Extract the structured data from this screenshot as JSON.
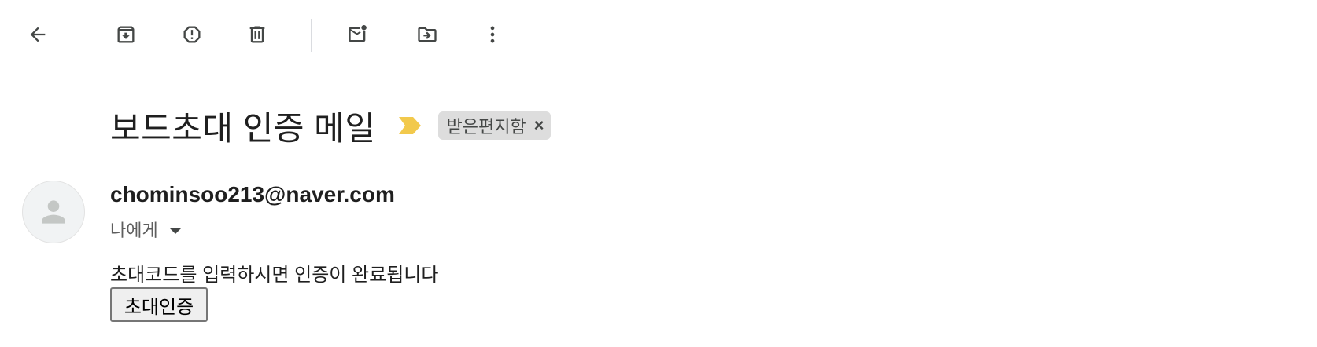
{
  "toolbar": {
    "icons": [
      "back-arrow-icon",
      "archive-icon",
      "report-spam-icon",
      "delete-icon",
      "mark-unread-icon",
      "move-to-icon",
      "more-vert-icon"
    ]
  },
  "message": {
    "subject": "보드초대 인증 메일",
    "importance_color": "#f2c94c",
    "label": "받은편지함",
    "label_close": "×"
  },
  "sender": {
    "email": "chominsoo213@naver.com",
    "recipient": "나에게"
  },
  "body": {
    "text": "초대코드를 입력하시면 인증이 완료됩니다",
    "button_label": "초대인증"
  }
}
